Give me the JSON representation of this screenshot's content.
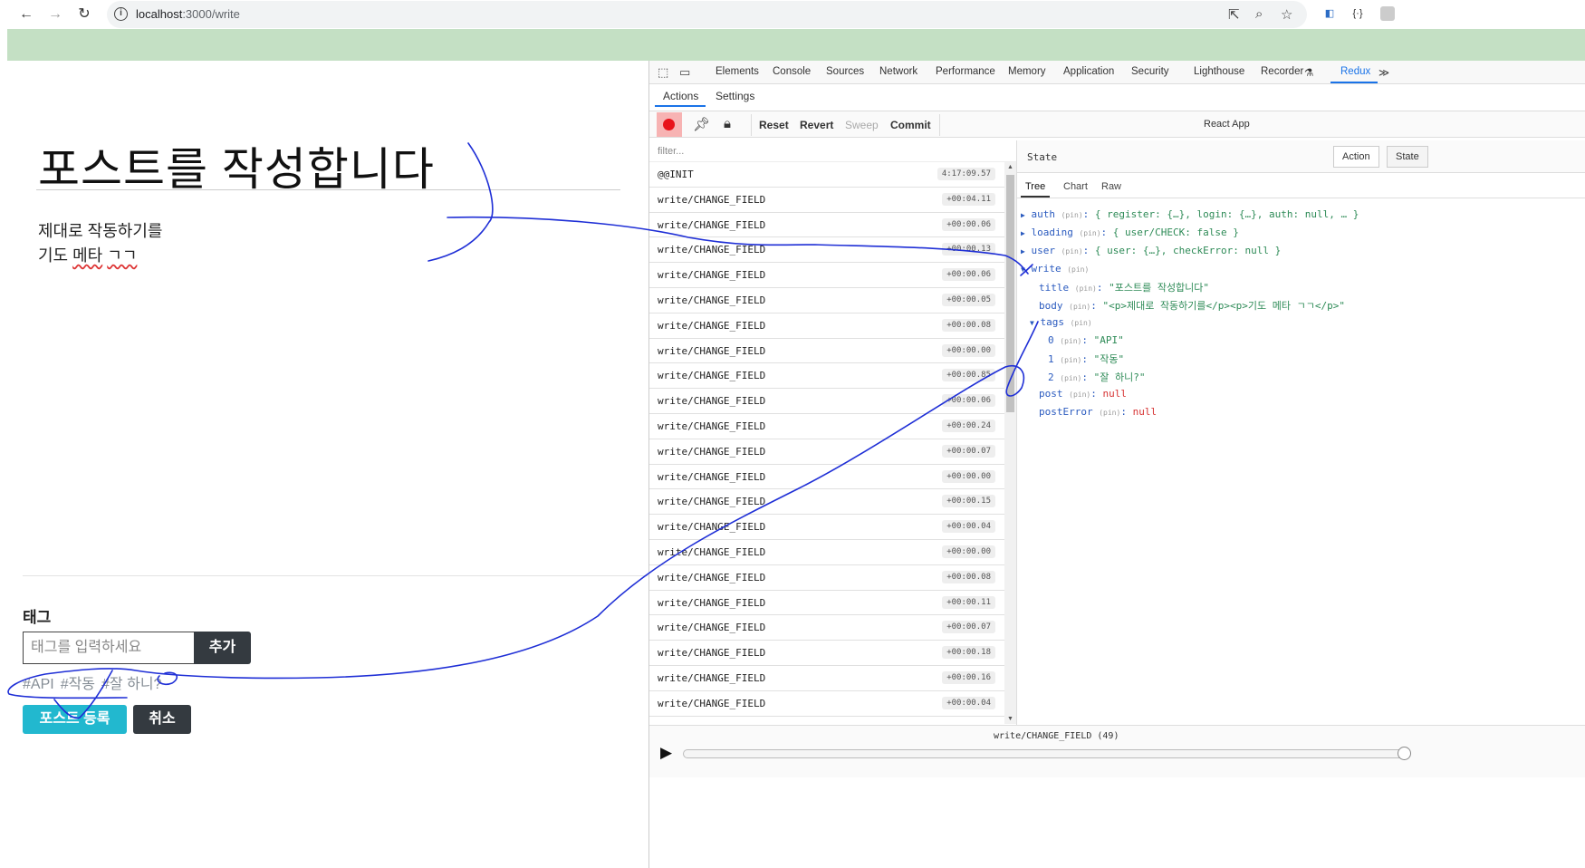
{
  "browser": {
    "url_host": "localhost",
    "url_rest": ":3000/write",
    "nav": {
      "back": "←",
      "forward": "→",
      "reload": "↻"
    }
  },
  "page": {
    "title": "포스트를 작성합니다",
    "body_line1": "제대로 작동하기를",
    "body_line2_a": "기도 ",
    "body_line2_b": "메타",
    "body_line2_c": " ",
    "body_line2_d": "ㄱㄱ",
    "tag_heading": "태그",
    "tag_placeholder": "태그를 입력하세요",
    "tag_add": "추가",
    "tags": [
      "#API",
      "#작동",
      "#잘 하니?"
    ],
    "submit": "포스트 등록",
    "cancel": "취소"
  },
  "devtools": {
    "tabs": [
      "Elements",
      "Console",
      "Sources",
      "Network",
      "Performance",
      "Memory",
      "Application",
      "Security",
      "Lighthouse",
      "Recorder",
      "Redux"
    ],
    "active_tab": "Redux",
    "more": "≫",
    "redux_tabs": [
      "Actions",
      "Settings"
    ],
    "toolbar": {
      "reset": "Reset",
      "revert": "Revert",
      "sweep": "Sweep",
      "commit": "Commit",
      "instance": "React App"
    },
    "filter_placeholder": "filter...",
    "actions": [
      {
        "name": "@@INIT",
        "time": "4:17:09.57"
      },
      {
        "name": "write/CHANGE_FIELD",
        "time": "+00:04.11"
      },
      {
        "name": "write/CHANGE_FIELD",
        "time": "+00:00.06"
      },
      {
        "name": "write/CHANGE_FIELD",
        "time": "+00:00.13"
      },
      {
        "name": "write/CHANGE_FIELD",
        "time": "+00:00.06"
      },
      {
        "name": "write/CHANGE_FIELD",
        "time": "+00:00.05"
      },
      {
        "name": "write/CHANGE_FIELD",
        "time": "+00:00.08"
      },
      {
        "name": "write/CHANGE_FIELD",
        "time": "+00:00.00"
      },
      {
        "name": "write/CHANGE_FIELD",
        "time": "+00:00.85"
      },
      {
        "name": "write/CHANGE_FIELD",
        "time": "+00:00.06"
      },
      {
        "name": "write/CHANGE_FIELD",
        "time": "+00:00.24"
      },
      {
        "name": "write/CHANGE_FIELD",
        "time": "+00:00.07"
      },
      {
        "name": "write/CHANGE_FIELD",
        "time": "+00:00.00"
      },
      {
        "name": "write/CHANGE_FIELD",
        "time": "+00:00.15"
      },
      {
        "name": "write/CHANGE_FIELD",
        "time": "+00:00.04"
      },
      {
        "name": "write/CHANGE_FIELD",
        "time": "+00:00.00"
      },
      {
        "name": "write/CHANGE_FIELD",
        "time": "+00:00.08"
      },
      {
        "name": "write/CHANGE_FIELD",
        "time": "+00:00.11"
      },
      {
        "name": "write/CHANGE_FIELD",
        "time": "+00:00.07"
      },
      {
        "name": "write/CHANGE_FIELD",
        "time": "+00:00.18"
      },
      {
        "name": "write/CHANGE_FIELD",
        "time": "+00:00.16"
      },
      {
        "name": "write/CHANGE_FIELD",
        "time": "+00:00.04"
      }
    ],
    "state_label": "State",
    "action_btn": "Action",
    "state_btn": "State",
    "state_tabs": [
      "Tree",
      "Chart",
      "Raw"
    ],
    "tree": {
      "pin": "(pin)",
      "auth_key": "auth",
      "auth_val": "{ register: {…}, login: {…}, auth: null, … }",
      "loading_key": "loading",
      "loading_val": "{ user/CHECK: false }",
      "user_key": "user",
      "user_val": "{ user: {…}, checkError: null }",
      "write_key": "write",
      "title_key": "title",
      "title_val": "\"포스트를 작성합니다\"",
      "body_key": "body",
      "body_val": "\"<p>제대로 작동하기를</p><p>기도 메타 ㄱㄱ</p>\"",
      "tags_key": "tags",
      "tag0_key": "0",
      "tag0_val": "\"API\"",
      "tag1_key": "1",
      "tag1_val": "\"작동\"",
      "tag2_key": "2",
      "tag2_val": "\"잘 하니?\"",
      "post_key": "post",
      "post_val": "null",
      "postError_key": "postError",
      "postError_val": "null"
    },
    "slider_label": "write/CHANGE_FIELD (49)"
  }
}
